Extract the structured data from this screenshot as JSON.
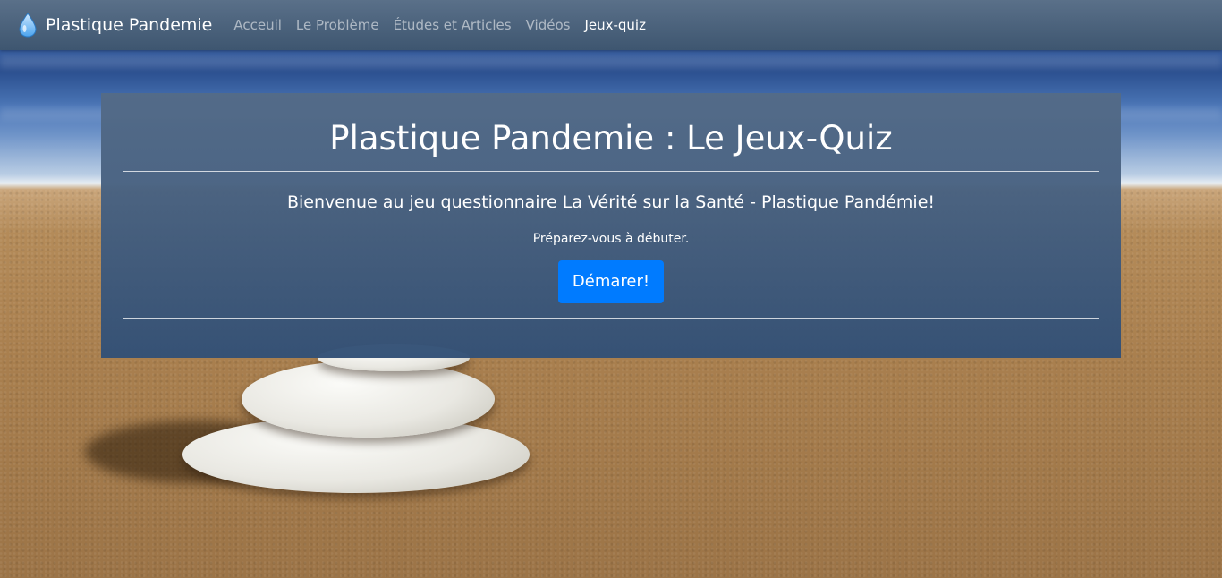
{
  "navbar": {
    "brand": "Plastique Pandemie",
    "brand_icon": "water-drop-icon",
    "links": [
      {
        "label": "Acceuil",
        "active": false
      },
      {
        "label": "Le Problème",
        "active": false
      },
      {
        "label": "Études et Articles",
        "active": false
      },
      {
        "label": "Vidéos",
        "active": false
      },
      {
        "label": "Jeux-quiz",
        "active": true
      }
    ]
  },
  "quiz": {
    "title": "Plastique Pandemie : Le Jeux-Quiz",
    "welcome": "Bienvenue au jeu questionnaire La Vérité sur la Santé - Plastique Pandémie!",
    "prepare": "Préparez-vous à débuter.",
    "start_label": "Démarer!"
  },
  "colors": {
    "navbar": "#4a6179",
    "panel": "#3f5d80",
    "button": "#007bff",
    "active_link": "#ffffff",
    "inactive_link": "#b5c0cc"
  }
}
